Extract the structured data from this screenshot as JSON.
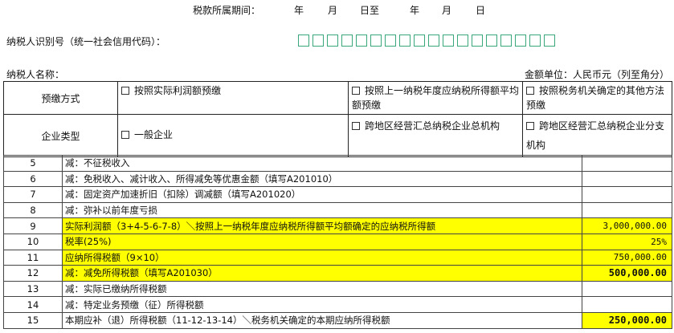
{
  "header": {
    "period_label": "税款所属期间：",
    "period_year": "年",
    "period_month": "月",
    "period_day_to": "日至",
    "period_year2": "年",
    "period_month2": "月",
    "period_day2": "日",
    "taxpayer_id_label": "纳税人识别号（统一社会信用代码）：",
    "taxpayer_name_label": "纳税人名称：",
    "amount_unit": "金额单位：人民币元（列至角分）"
  },
  "prepay": {
    "label": "预缴方式",
    "option1": "按照实际利润额预缴",
    "option2": "按照上一纳税年度应纳税所得额平均额预缴",
    "option3": "按照税务机关确定的其他方法预缴"
  },
  "enterprise": {
    "label": "企业类型",
    "option1": "一般企业",
    "option2": "跨地区经营汇总纳税企业总机构",
    "option3": "跨地区经营汇总纳税企业分支机构"
  },
  "rows": [
    {
      "num": "5",
      "desc": "减：不征税收入",
      "amount": "",
      "highlight": false,
      "bold": false
    },
    {
      "num": "6",
      "desc": "减：免税收入、减计收入、所得减免等优惠金额（填写A201010）",
      "amount": "",
      "highlight": false,
      "bold": false
    },
    {
      "num": "7",
      "desc": "减：固定资产加速折旧（扣除）调减额（填写A201020）",
      "amount": "",
      "highlight": false,
      "bold": false
    },
    {
      "num": "8",
      "desc": "减：弥补以前年度亏损",
      "amount": "",
      "highlight": false,
      "bold": false
    },
    {
      "num": "9",
      "desc": "实际利润额（3+4-5-6-7-8）＼按照上一纳税年度应纳税所得额平均额确定的应纳税所得额",
      "amount": "3,000,000.00",
      "highlight": true,
      "bold": false
    },
    {
      "num": "10",
      "desc": "税率(25%)",
      "amount": "25%",
      "highlight": true,
      "bold": false
    },
    {
      "num": "11",
      "desc": "应纳所得税额（9×10）",
      "amount": "750,000.00",
      "highlight": true,
      "bold": false
    },
    {
      "num": "12",
      "desc": "减：减免所得税额（填写A201030）",
      "amount": "500,000.00",
      "highlight": true,
      "bold": true
    },
    {
      "num": "13",
      "desc": "减：实际已缴纳所得税额",
      "amount": "",
      "highlight": false,
      "bold": false
    },
    {
      "num": "14",
      "desc": "减：特定业务预缴（征）所得税额",
      "amount": "",
      "highlight": false,
      "bold": false
    },
    {
      "num": "15",
      "desc": "本期应补（退）所得税额（11-12-13-14）＼税务机关确定的本期应纳所得税额",
      "amount": "250,000.00",
      "highlight": false,
      "bold": true,
      "amount_highlight": true
    }
  ]
}
